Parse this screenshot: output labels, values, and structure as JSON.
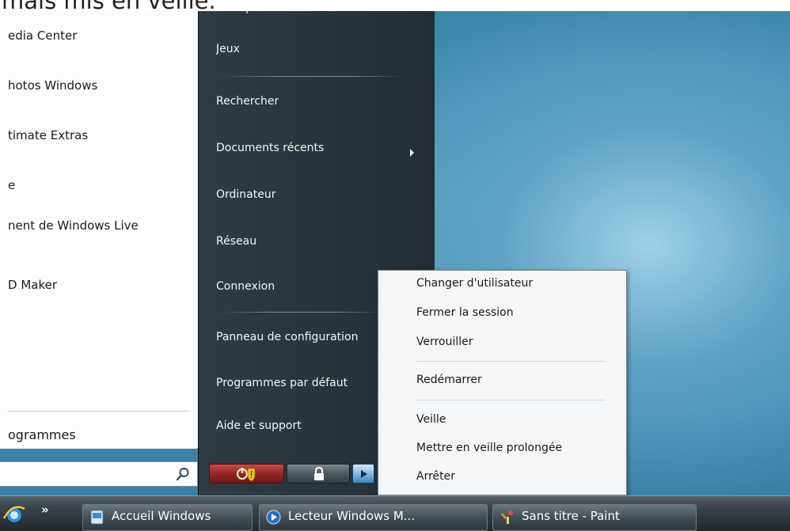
{
  "caption": {
    "text": "mais mis en veille."
  },
  "left_panel": {
    "items": [
      "edia Center",
      "hotos Windows",
      "timate Extras",
      "e",
      "nent de Windows Live",
      "D Maker"
    ],
    "all_programs": "ogrammes"
  },
  "right_panel": {
    "items": {
      "musique": "Musique",
      "jeux": "Jeux",
      "rechercher": "Rechercher",
      "documents_recents": "Documents récents",
      "ordinateur": "Ordinateur",
      "reseau": "Réseau",
      "connexion": "Connexion",
      "panneau": "Panneau de configuration",
      "programmes_defaut": "Programmes par défaut",
      "aide": "Aide et support"
    }
  },
  "shutdown_menu": {
    "items": {
      "changer": "Changer d'utilisateur",
      "fermer": "Fermer la session",
      "verrouiller": "Verrouiller",
      "redemarrer": "Redémarrer",
      "veille": "Veille",
      "veille_prolongee": "Mettre en veille prolongée",
      "arreter": "Arrêter"
    }
  },
  "taskbar": {
    "quicklaunch_more": "»",
    "buttons": [
      "Accueil Windows",
      "Lecteur Windows M...",
      "Sans titre - Paint"
    ]
  },
  "colors": {
    "desktop": "#3c86a8",
    "menu_dark": "#2f3b44",
    "power_red": "#9b2a2a",
    "taskbar": "#2b3338"
  }
}
